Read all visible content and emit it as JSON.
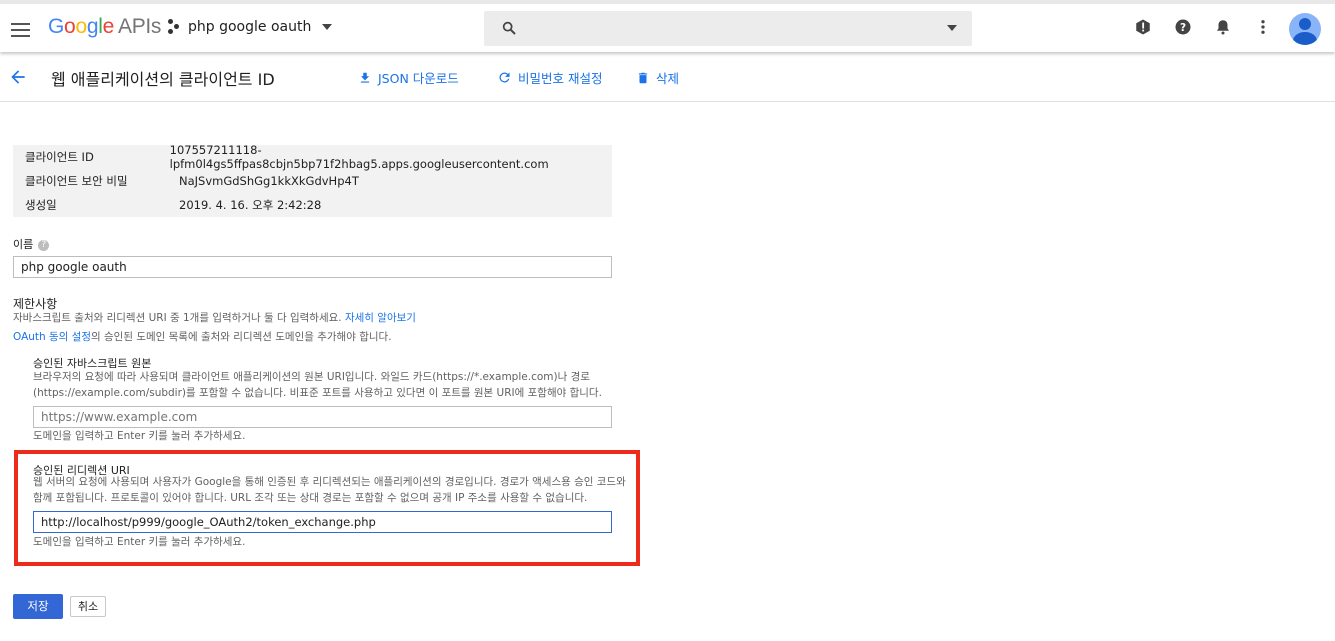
{
  "topbar": {
    "logo_google": "Google",
    "logo_apis": "APIs",
    "project": "php google oauth",
    "search_placeholder": ""
  },
  "page": {
    "title": "웹 애플리케이션의 클라이언트 ID",
    "actions": {
      "download": "JSON 다운로드",
      "reset": "비밀번호 재설정",
      "delete": "삭제"
    }
  },
  "info": [
    {
      "label": "클라이언트 ID",
      "value": "107557211118-lpfm0l4gs5ffpas8cbjn5bp71f2hbag5.apps.googleusercontent.com"
    },
    {
      "label": "클라이언트 보안 비밀",
      "value": "NaJSvmGdShGg1kkXkGdvHp4T"
    },
    {
      "label": "생성일",
      "value": "2019. 4. 16. 오후 2:42:28"
    }
  ],
  "name": {
    "label": "이름",
    "help": "?",
    "value": "php google oauth"
  },
  "restrictions": {
    "title": "제한사항",
    "desc": "자바스크립트 출처와 리디렉션 URI 중 1개를 입력하거나 둘 다 입력하세요.",
    "learn_more": "자세히 알아보기",
    "oauth_link": "OAuth 동의 설정",
    "oauth_text": "의 승인된 도메인 목록에 출처와 리디렉션 도메인을 추가해야 합니다."
  },
  "js_origins": {
    "title": "승인된 자바스크립트 원본",
    "desc1": "브라우저의 요청에 따라 사용되며 클라이언트 애플리케이션의 원본 URI입니다. 와일드 카드(https://*.example.com)나 경로",
    "desc2": "(https://example.com/subdir)를 포함할 수 없습니다. 비표준 포트를 사용하고 있다면 이 포트를 원본 URI에 포함해야 합니다.",
    "placeholder": "https://www.example.com",
    "hint": "도메인을 입력하고 Enter 키를 눌러 추가하세요."
  },
  "redirect": {
    "title": "승인된 리디렉션 URI",
    "desc1": "웹 서버의 요청에 사용되며 사용자가 Google을 통해 인증된 후 리디렉션되는 애플리케이션의 경로입니다. 경로가 액세스용 승인 코드와",
    "desc2": "함께 포함됩니다. 프로토콜이 있어야 합니다. URL 조각 또는 상대 경로는 포함할 수 없으며 공개 IP 주소를 사용할 수 없습니다.",
    "value": "http://localhost/p999/google_OAuth2/token_exchange.php",
    "hint": "도메인을 입력하고 Enter 키를 눌러 추가하세요.",
    "highlight_color": "#ee2a1b"
  },
  "buttons": {
    "save": "저장",
    "cancel": "취소"
  },
  "colors": {
    "accent": "#1a73e8",
    "primary_button": "#3367d6"
  }
}
